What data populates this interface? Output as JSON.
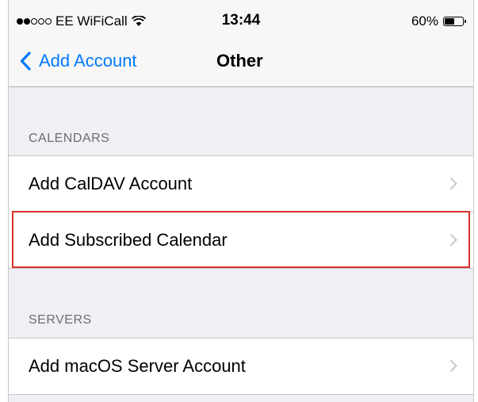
{
  "status_bar": {
    "carrier": "EE WiFiCall",
    "time": "13:44",
    "battery_percent": "60%",
    "battery_level": 0.6,
    "signal_bars_filled": 2,
    "signal_bars_total": 5
  },
  "nav": {
    "back_label": "Add Account",
    "title": "Other"
  },
  "sections": [
    {
      "header": "CALENDARS",
      "items": [
        {
          "label": "Add CalDAV Account"
        },
        {
          "label": "Add Subscribed Calendar"
        }
      ]
    },
    {
      "header": "SERVERS",
      "items": [
        {
          "label": "Add macOS Server Account"
        }
      ]
    }
  ],
  "colors": {
    "accent": "#007aff",
    "highlight_box": "#d9322b",
    "background": "#efeff4"
  }
}
